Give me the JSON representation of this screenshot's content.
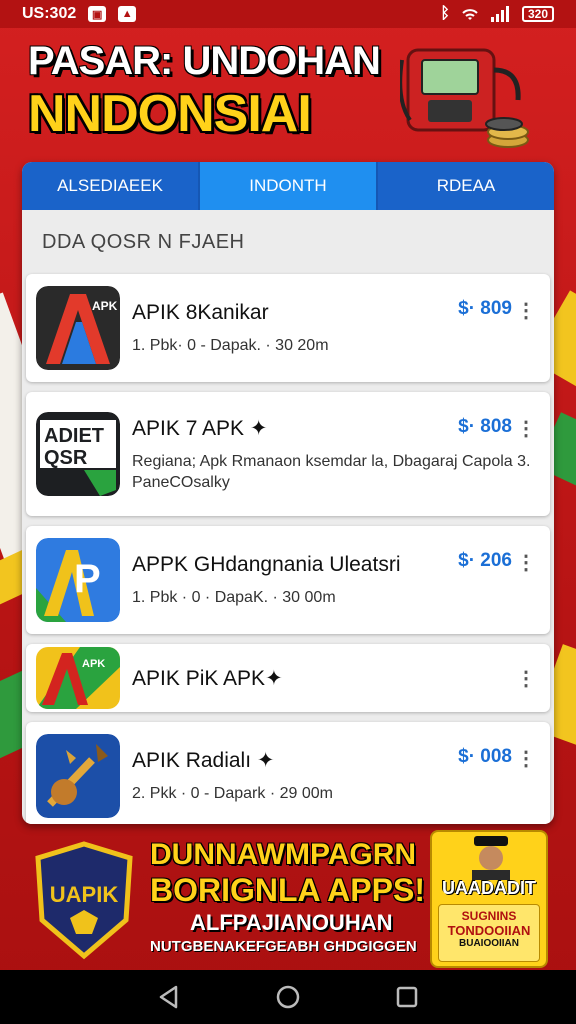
{
  "status_bar": {
    "time": "US:302",
    "battery": "320"
  },
  "header": {
    "line1": "PASAR: UNDOHAN",
    "line2": "NNDONSIAI"
  },
  "tabs": [
    {
      "label": "ALSEDIAEEK"
    },
    {
      "label": "INDONTH"
    },
    {
      "label": "RDEAA"
    }
  ],
  "section_title": "DDA QOSR N FJAEH",
  "apps": [
    {
      "name": "APIK 8Kanikar",
      "meta": "1. Pbk· 0 - Dapak. · 30 20m",
      "price": "$· 809",
      "icon_text": "APK"
    },
    {
      "name": "APIK 7 APK ✦",
      "meta": "Regiana; Apk Rmanaon ksemdar la, Dbagaraj Capola 3. PaneCOsalky",
      "price": "$· 808",
      "icon_text": "ADIET QSR"
    },
    {
      "name": "APPK GHdangnania Uleatsri",
      "meta": "1. Pbk · 0 · DapaK. · 30 00m",
      "price": "$· 206",
      "icon_text": "AP"
    },
    {
      "name": "APIK PiK APK✦",
      "meta": "",
      "price": "",
      "icon_text": "APK"
    },
    {
      "name": "APIK Radialı ✦",
      "meta": "2. Pkk · 0 - Dapark · 29 00m",
      "price": "$· 008",
      "icon_text": ""
    }
  ],
  "banner": {
    "line1": "DUNNAWMPAGRN",
    "line2": "BORIGNLA APPS!",
    "line3": "ALFPAJIANOUHAN",
    "line4": "NUTGBENAKEFGEABH GHDGIGGEN",
    "badge_text": "UAPIK",
    "promo_title": "UAADADIT",
    "promo_line1": "SUGNINS",
    "promo_line2": "TONDOOIIAN",
    "promo_line3": "BUAIOOIIAN"
  },
  "colors": {
    "brand_red": "#c81b1b",
    "tab_blue": "#1a63c9",
    "tab_active": "#1f8ff0",
    "price_blue": "#1b6fd6",
    "gold": "#ffd21a"
  }
}
